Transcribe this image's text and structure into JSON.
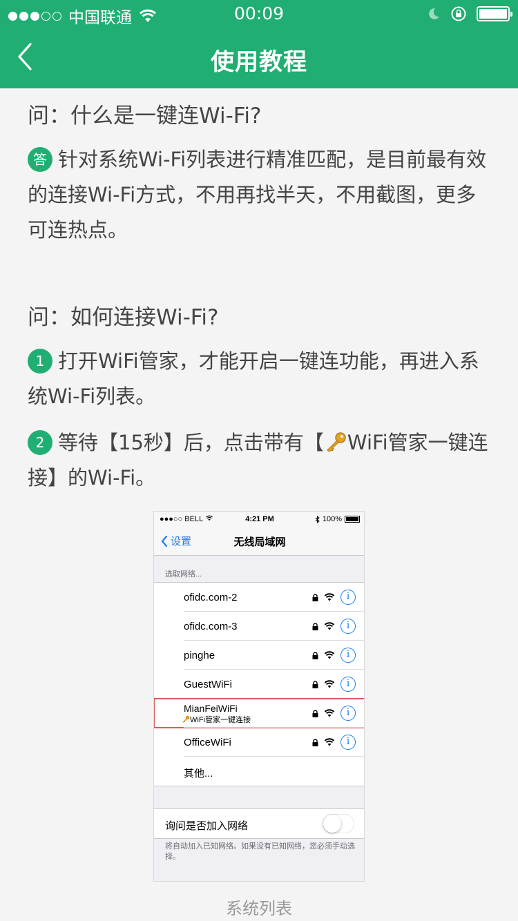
{
  "status_bar": {
    "carrier": "中国联通",
    "time": "00:09"
  },
  "nav": {
    "title": "使用教程"
  },
  "faq1": {
    "question": "问：什么是一键连Wi-Fi?",
    "answer_badge": "答",
    "answer": "针对系统Wi-Fi列表进行精准匹配，是目前最有效的连接Wi-Fi方式，不用再找半天，不用截图，更多可连热点。"
  },
  "faq2": {
    "question": "问：如何连接Wi-Fi?",
    "step1_badge": "1",
    "step1": "打开WiFi管家，才能开启一键连功能，再进入系统Wi-Fi列表。",
    "step2_badge": "2",
    "step2_before": "等待【15秒】后，点击带有【",
    "step2_after": "WiFi管家一键连接】的Wi-Fi。"
  },
  "screenshot": {
    "status": {
      "carrier": "BELL",
      "time": "4:21 PM",
      "battery": "100%"
    },
    "back_label": "设置",
    "title": "无线局域网",
    "section_label": "选取网络...",
    "networks": [
      {
        "name": "ofidc.com-2"
      },
      {
        "name": "ofidc.com-3"
      },
      {
        "name": "pinghe"
      },
      {
        "name": "GuestWiFi"
      },
      {
        "name": "MianFeiWiFi",
        "tag": "WiFi管家一键连接",
        "highlighted": true
      },
      {
        "name": "OfficeWiFi"
      },
      {
        "name": "其他..."
      }
    ],
    "info_glyph": "i",
    "ask_label": "询问是否加入网络",
    "ask_toggle_on": false,
    "footer": "将自动加入已知网络。如果没有已知网络，您必须手动选择。"
  },
  "caption": "系统列表",
  "colors": {
    "brand_green": "#20ae73",
    "ios_blue": "#1a7ef5",
    "highlight_red": "#e05a5a"
  }
}
